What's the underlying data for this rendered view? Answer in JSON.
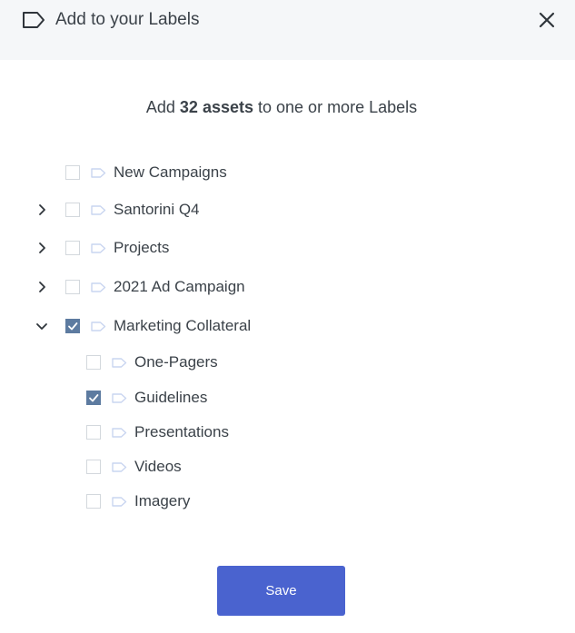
{
  "header": {
    "title": "Add to your Labels",
    "icon": "label-tag-icon",
    "close_icon": "close-icon"
  },
  "subtitle": {
    "prefix": "Add",
    "count_text": "32 assets",
    "suffix": "to one or more Labels"
  },
  "labels": [
    {
      "label": "New Campaigns",
      "level": 0,
      "expandable": false,
      "expanded": false,
      "checked": false
    },
    {
      "label": "Santorini Q4",
      "level": 0,
      "expandable": true,
      "expanded": false,
      "checked": false
    },
    {
      "label": "Projects",
      "level": 0,
      "expandable": true,
      "expanded": false,
      "checked": false
    },
    {
      "label": "2021 Ad Campaign",
      "level": 0,
      "expandable": true,
      "expanded": false,
      "checked": false
    },
    {
      "label": "Marketing Collateral",
      "level": 0,
      "expandable": true,
      "expanded": true,
      "checked": true
    },
    {
      "label": "One-Pagers",
      "level": 1,
      "expandable": false,
      "expanded": false,
      "checked": false
    },
    {
      "label": "Guidelines",
      "level": 1,
      "expandable": false,
      "expanded": false,
      "checked": true
    },
    {
      "label": "Presentations",
      "level": 1,
      "expandable": false,
      "expanded": false,
      "checked": false
    },
    {
      "label": "Videos",
      "level": 1,
      "expandable": false,
      "expanded": false,
      "checked": false
    },
    {
      "label": "Imagery",
      "level": 1,
      "expandable": false,
      "expanded": false,
      "checked": false
    }
  ],
  "save_label": "Save",
  "colors": {
    "header_bg": "#f5f7f9",
    "checkbox_checked": "#5d7ba0",
    "tag_icon": "#c9d5f0",
    "save_button": "#4a63cf"
  }
}
